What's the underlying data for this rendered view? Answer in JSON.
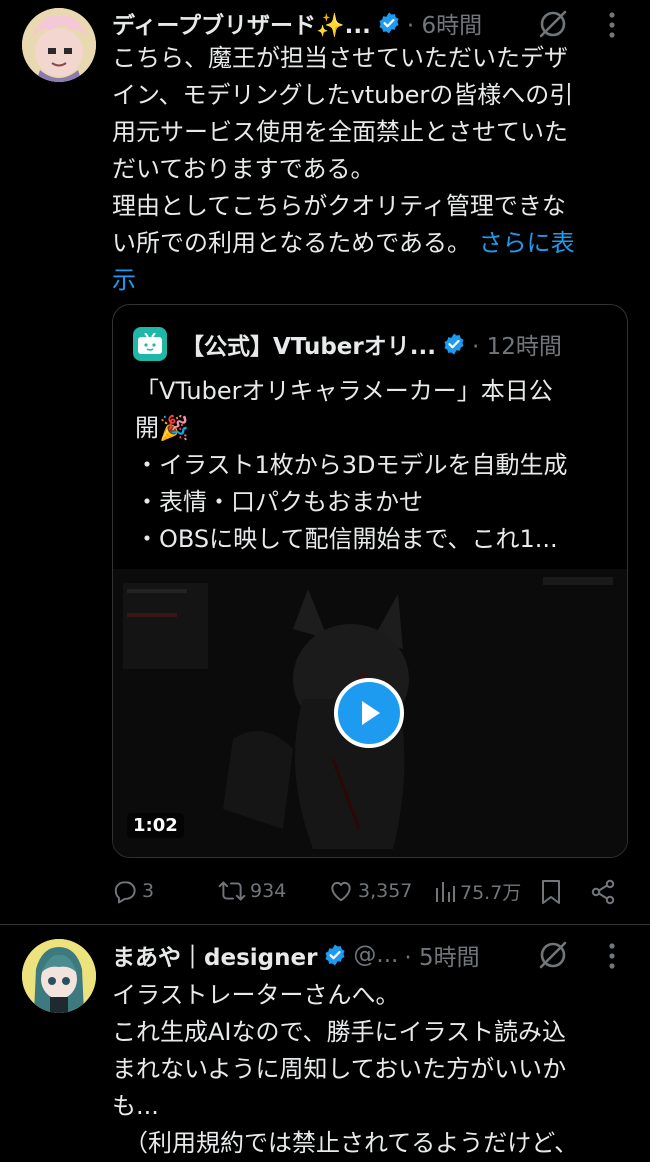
{
  "tweet1": {
    "display_name": "ディープブリザード✨...",
    "time": "· 6時間",
    "icons": {
      "avatar": "avatar-pink-hair",
      "verified": "verified-badge",
      "grok": "grok-icon",
      "more": "more-icon"
    },
    "text_lines": [
      "こちら、魔王が担当させていただいたデザ",
      "イン、モデリングしたvtuberの皆様への引",
      "用元サービス使用を全面禁止とさせていた",
      "だいておりますである。",
      "理由としてこちらがクオリティ管理できな",
      "い所での利用となるためである。"
    ],
    "show_more": "さらに表",
    "show_more_2": "示",
    "quote": {
      "display_name": "【公式】VTuberオリ...",
      "time": "· 12時間",
      "text_lines": [
        "「VTuberオリキャラメーカー」本日公",
        "開🎉",
        "・イラスト1枚から3Dモデルを自動生成",
        "・表情・口パクもおまかせ",
        "・OBSに映して配信開始まで、これ1..."
      ],
      "video_duration": "1:02",
      "icons": {
        "avatar": "tv-logo-icon",
        "play": "play-icon"
      }
    },
    "stats": {
      "replies": "3",
      "retweets": "934",
      "likes": "3,357",
      "views": "75.7万"
    }
  },
  "tweet2": {
    "display_name": "まあや｜designer",
    "handle": "@...",
    "time": "· 5時間",
    "icons": {
      "avatar": "avatar-teal-hair",
      "verified": "verified-badge",
      "grok": "grok-icon",
      "more": "more-icon"
    },
    "text_lines": [
      "イラストレーターさんへ。",
      "これ生成AIなので、勝手にイラスト読み込",
      "まれないように周知しておいた方がいいか",
      "も...",
      "（利用規約では禁止されてるようだけど、"
    ]
  },
  "colors": {
    "accent": "#1d9bf0",
    "muted": "#71767b",
    "text": "#e7e9ea",
    "border": "#2f3336"
  }
}
